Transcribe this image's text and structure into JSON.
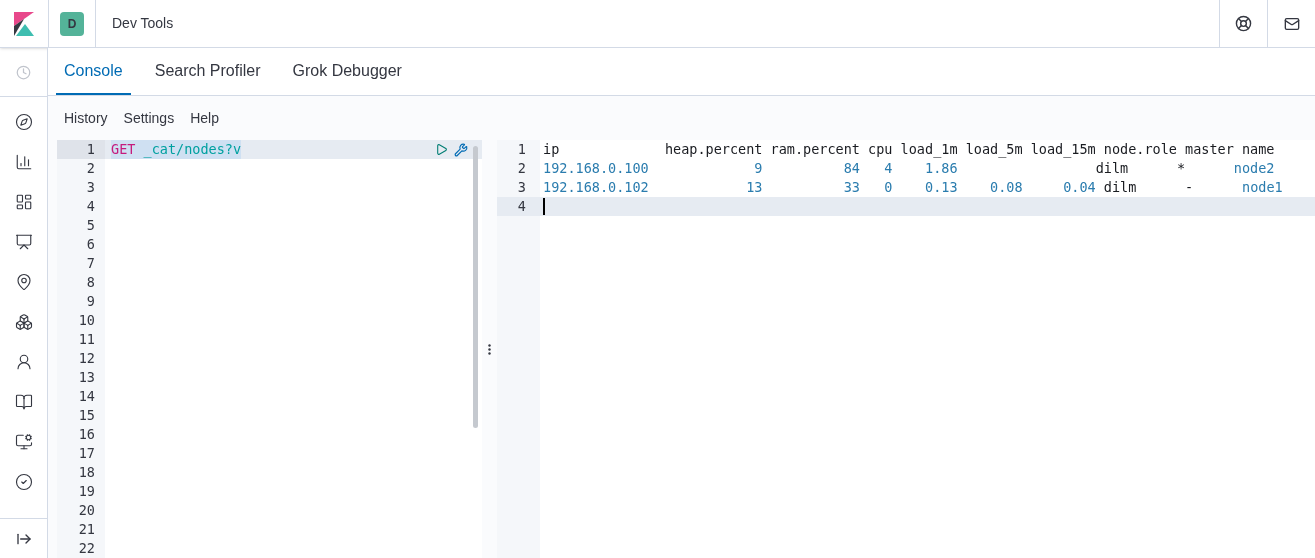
{
  "header": {
    "space_initial": "D",
    "title": "Dev Tools"
  },
  "tabs": [
    {
      "label": "Console",
      "selected": true
    },
    {
      "label": "Search Profiler",
      "selected": false
    },
    {
      "label": "Grok Debugger",
      "selected": false
    }
  ],
  "menu": [
    "History",
    "Settings",
    "Help"
  ],
  "request": {
    "method": "GET",
    "path": "_cat/nodes?v",
    "line_numbers": [
      "1",
      "2",
      "3",
      "4",
      "5",
      "6",
      "7",
      "8",
      "9",
      "10",
      "11",
      "12",
      "13",
      "14",
      "15",
      "16",
      "17",
      "18",
      "19",
      "20",
      "21",
      "22"
    ]
  },
  "response": {
    "line_numbers": [
      "1",
      "2",
      "3",
      "4"
    ],
    "lines": [
      [
        {
          "text": "ip             heap.percent ram.percent cpu load_1m load_5m load_15m node.role master name",
          "kind": "plain"
        }
      ],
      [
        {
          "text": "192.168.0.100             9          84   4    1.86",
          "kind": "value"
        },
        {
          "text": "                 dilm      *      ",
          "kind": "plain"
        },
        {
          "text": "node2",
          "kind": "value"
        }
      ],
      [
        {
          "text": "192.168.0.102            13          33   0    0.13    0.08     0.04",
          "kind": "value"
        },
        {
          "text": " dilm      -      ",
          "kind": "plain"
        },
        {
          "text": "node1",
          "kind": "value"
        }
      ]
    ]
  }
}
